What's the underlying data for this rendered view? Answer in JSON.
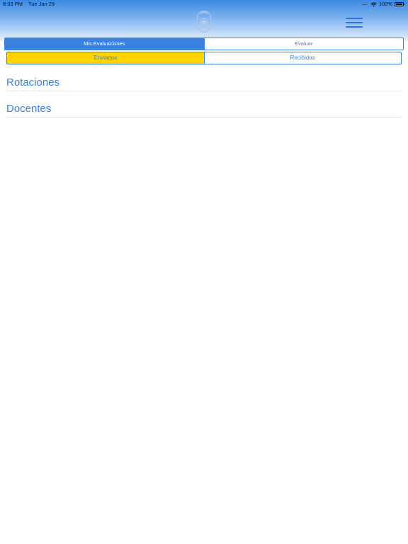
{
  "status_bar": {
    "time": "8:03 PM",
    "date": "Tue Jan 29",
    "battery": "100%"
  },
  "header": {
    "logo_icon": "coat-of-arms-icon",
    "menu_icon": "hamburger-menu-icon"
  },
  "top_tabs": [
    {
      "label": "Mis Evaluaciones",
      "active": true
    },
    {
      "label": "Evaluar",
      "active": false
    }
  ],
  "sub_tabs": [
    {
      "label": "Enviadas",
      "active": true
    },
    {
      "label": "Recibidas",
      "active": false
    }
  ],
  "sections": [
    {
      "title": "Rotaciones"
    },
    {
      "title": "Docentes"
    }
  ],
  "colors": {
    "accent": "#3a82e0",
    "highlight": "#ffd400"
  }
}
